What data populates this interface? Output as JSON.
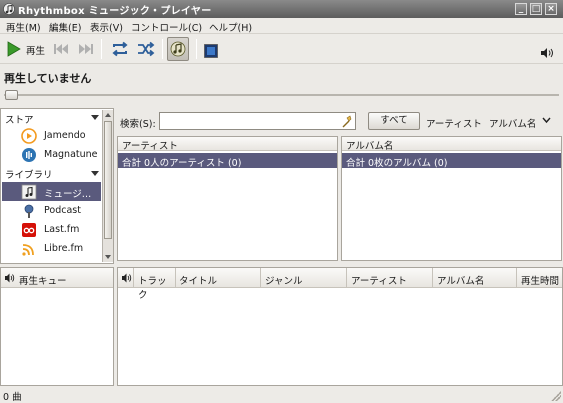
{
  "window": {
    "title": "Rhythmbox ミュージック・プレイヤー"
  },
  "menu": [
    {
      "label": "再生(M)",
      "key": "play"
    },
    {
      "label": "編集(E)",
      "key": "edit"
    },
    {
      "label": "表示(V)",
      "key": "view"
    },
    {
      "label": "コントロール(C)",
      "key": "control"
    },
    {
      "label": "ヘルプ(H)",
      "key": "help"
    }
  ],
  "toolbar": {
    "play_label": "再生"
  },
  "now_playing": {
    "status": "再生していません"
  },
  "sources": {
    "store_header": "ストア",
    "library_header": "ライブラリ",
    "items": [
      {
        "label": "Jamendo"
      },
      {
        "label": "Magnatune"
      },
      {
        "label": "ミュージ…"
      },
      {
        "label": "Podcast"
      },
      {
        "label": "Last.fm"
      },
      {
        "label": "Libre.fm"
      }
    ]
  },
  "search": {
    "label": "検索(S):",
    "value": "",
    "all_button": "すべて",
    "filter_artist": "アーティスト",
    "filter_album": "アルバム名"
  },
  "browser": {
    "artist_header": "アーティスト",
    "artist_row": "合計 0人のアーティスト (0)",
    "album_header": "アルバム名",
    "album_row": "合計 0枚のアルバム (0)"
  },
  "queue": {
    "label": "再生キュー"
  },
  "tracklist": {
    "columns": [
      "トラック",
      "タイトル",
      "ジャンル",
      "アーティスト",
      "アルバム名",
      "再生時間"
    ]
  },
  "status_bar": {
    "text": "0 曲"
  },
  "colors": {
    "selection": "#5a5a7d",
    "titlebar": "#6e6e6e",
    "play_green": "#3a9a2a"
  }
}
